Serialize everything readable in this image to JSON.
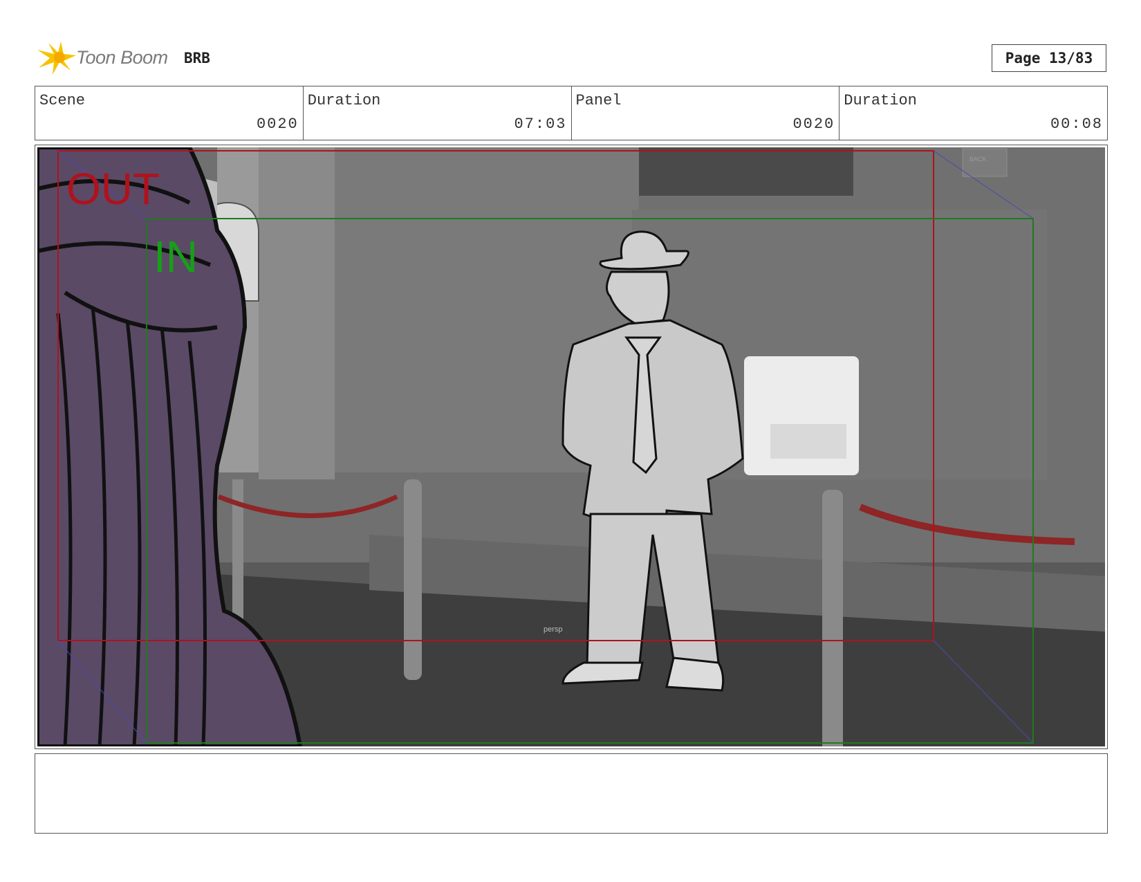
{
  "header": {
    "brand_name": "Toon Boom",
    "project_code": "BRB",
    "page_label": "Page 13/83"
  },
  "info": {
    "scene_label": "Scene",
    "scene_value": "0020",
    "scene_duration_label": "Duration",
    "scene_duration_value": "07:03",
    "panel_label": "Panel",
    "panel_value": "0020",
    "panel_duration_label": "Duration",
    "panel_duration_value": "00:08"
  },
  "panel": {
    "safe_out_label": "OUT",
    "safe_in_label": "IN",
    "viewport_label": "persp",
    "back_button_label": "BACK"
  },
  "colors": {
    "out_frame": "#b0121c",
    "in_frame": "#1f7a1f",
    "in_label": "#16a016",
    "cloak": "#5a4a66",
    "rope": "#8e2526"
  }
}
